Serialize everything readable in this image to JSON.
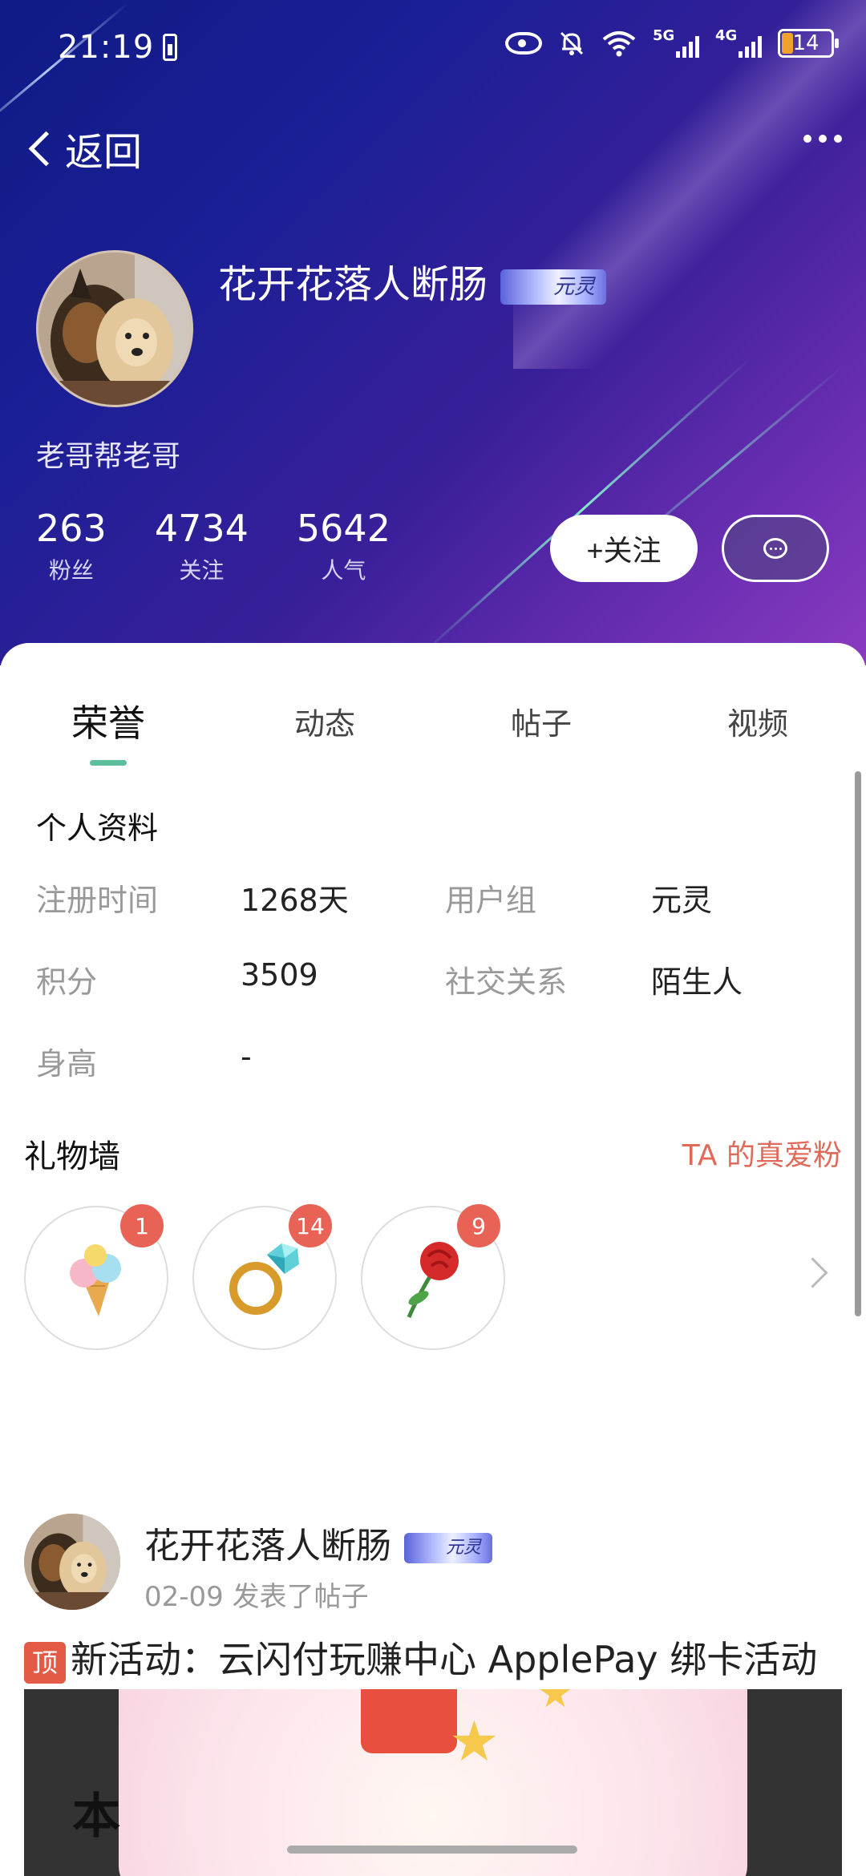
{
  "status_bar": {
    "time": "21:19",
    "network_5g": "5G",
    "network_4g": "4G",
    "battery": "14"
  },
  "nav": {
    "back_label": "返回"
  },
  "profile": {
    "nickname": "花开花落人断肠",
    "badge_text": "元灵",
    "signature": "老哥帮老哥",
    "stats": [
      {
        "num": "263",
        "label": "粉丝"
      },
      {
        "num": "4734",
        "label": "关注"
      },
      {
        "num": "5642",
        "label": "人气"
      }
    ],
    "follow_label": "+关注"
  },
  "tabs": [
    {
      "label": "荣誉",
      "active": true
    },
    {
      "label": "动态",
      "active": false
    },
    {
      "label": "帖子",
      "active": false
    },
    {
      "label": "视频",
      "active": false
    }
  ],
  "info": {
    "title": "个人资料",
    "fields": [
      {
        "label": "注册时间",
        "value": "1268天"
      },
      {
        "label": "用户组",
        "value": "元灵"
      },
      {
        "label": "积分",
        "value": "3509"
      },
      {
        "label": "社交关系",
        "value": "陌生人"
      },
      {
        "label": "身高",
        "value": "-"
      }
    ]
  },
  "gifts": {
    "title": "礼物墙",
    "link": "TA 的真爱粉",
    "items": [
      {
        "icon": "ice-cream-icon",
        "count": "1"
      },
      {
        "icon": "diamond-ring-icon",
        "count": "14"
      },
      {
        "icon": "rose-icon",
        "count": "9"
      }
    ]
  },
  "post": {
    "author": "花开花落人断肠",
    "badge_text": "元灵",
    "meta": "02-09 发表了帖子",
    "pin_label": "顶",
    "title": "新活动：云闪付玩赚中心 ApplePay 绑卡活动",
    "image_glyph": "本"
  },
  "colors": {
    "accent_green": "#5bbf9c",
    "link_red": "#e06a5a",
    "badge_red": "#e86355"
  }
}
